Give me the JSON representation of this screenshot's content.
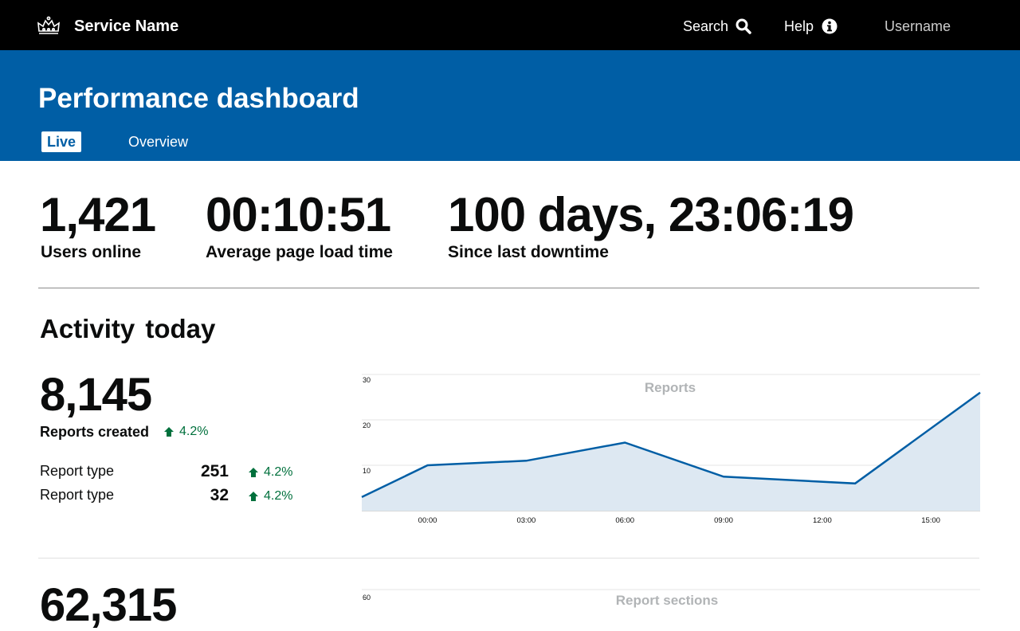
{
  "header": {
    "service_name": "Service Name",
    "search_label": "Search",
    "help_label": "Help",
    "username": "Username"
  },
  "banner": {
    "title": "Performance dashboard",
    "tabs": [
      {
        "label": "Live",
        "active": true
      },
      {
        "label": "Overview",
        "active": false
      }
    ]
  },
  "kpis": [
    {
      "value": "1,421",
      "label": "Users online"
    },
    {
      "value": "00:10:51",
      "label": "Average page load time"
    },
    {
      "value": "100 days, 23:06:19",
      "label": "Since last downtime"
    }
  ],
  "activity": {
    "title": "Activity today",
    "reports": {
      "total": "8,145",
      "label": "Reports created",
      "change": "4.2%",
      "rows": [
        {
          "label": "Report type",
          "value": "251",
          "change": "4.2%"
        },
        {
          "label": "Report type",
          "value": "32",
          "change": "4.2%"
        }
      ]
    },
    "sections_total": "62,315"
  },
  "colors": {
    "header_bg": "#000000",
    "banner_bg": "#005ea5",
    "positive": "#00703c",
    "chart_line": "#005ea5",
    "chart_fill": "#dde8f2"
  },
  "chart_data": [
    {
      "type": "area",
      "title": "Reports",
      "x": [
        "",
        "00:00",
        "",
        "03:00",
        "06:00",
        "09:00",
        "12:00",
        "15:00"
      ],
      "x_ticks": [
        "00:00",
        "03:00",
        "06:00",
        "09:00",
        "12:00",
        "15:00"
      ],
      "values": [
        3,
        10,
        11,
        15,
        7.5,
        6,
        26
      ],
      "series_x_hours": [
        -2.5,
        -0.5,
        2.5,
        5.5,
        8.5,
        12.5,
        16.3
      ],
      "y_ticks": [
        10,
        20,
        30
      ],
      "ylim": [
        0,
        30
      ],
      "grid": true
    },
    {
      "type": "area",
      "title": "Report sections",
      "y_ticks": [
        60
      ],
      "grid": true
    }
  ]
}
